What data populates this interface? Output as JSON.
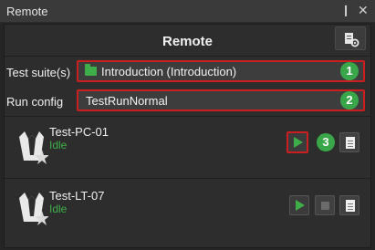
{
  "window": {
    "title": "Remote",
    "pin_glyph": "❙",
    "close_glyph": "✕"
  },
  "header": {
    "title": "Remote",
    "settings_icon": "settings-icon"
  },
  "form": {
    "test_suite": {
      "label": "Test suite(s)",
      "value": "Introduction (Introduction)",
      "icon": "folder-icon",
      "callout": "1"
    },
    "run_config": {
      "label": "Run config",
      "value": "TestRunNormal",
      "callout": "2"
    }
  },
  "agents": [
    {
      "name": "Test-PC-01",
      "status": "Idle",
      "icon": "agent-icon",
      "callout": "3"
    },
    {
      "name": "Test-LT-07",
      "status": "Idle",
      "icon": "agent-icon"
    }
  ],
  "colors": {
    "accent_green": "#3fae49",
    "highlight_red": "#cc1e1e",
    "panel_bg": "#2d2d2d"
  }
}
